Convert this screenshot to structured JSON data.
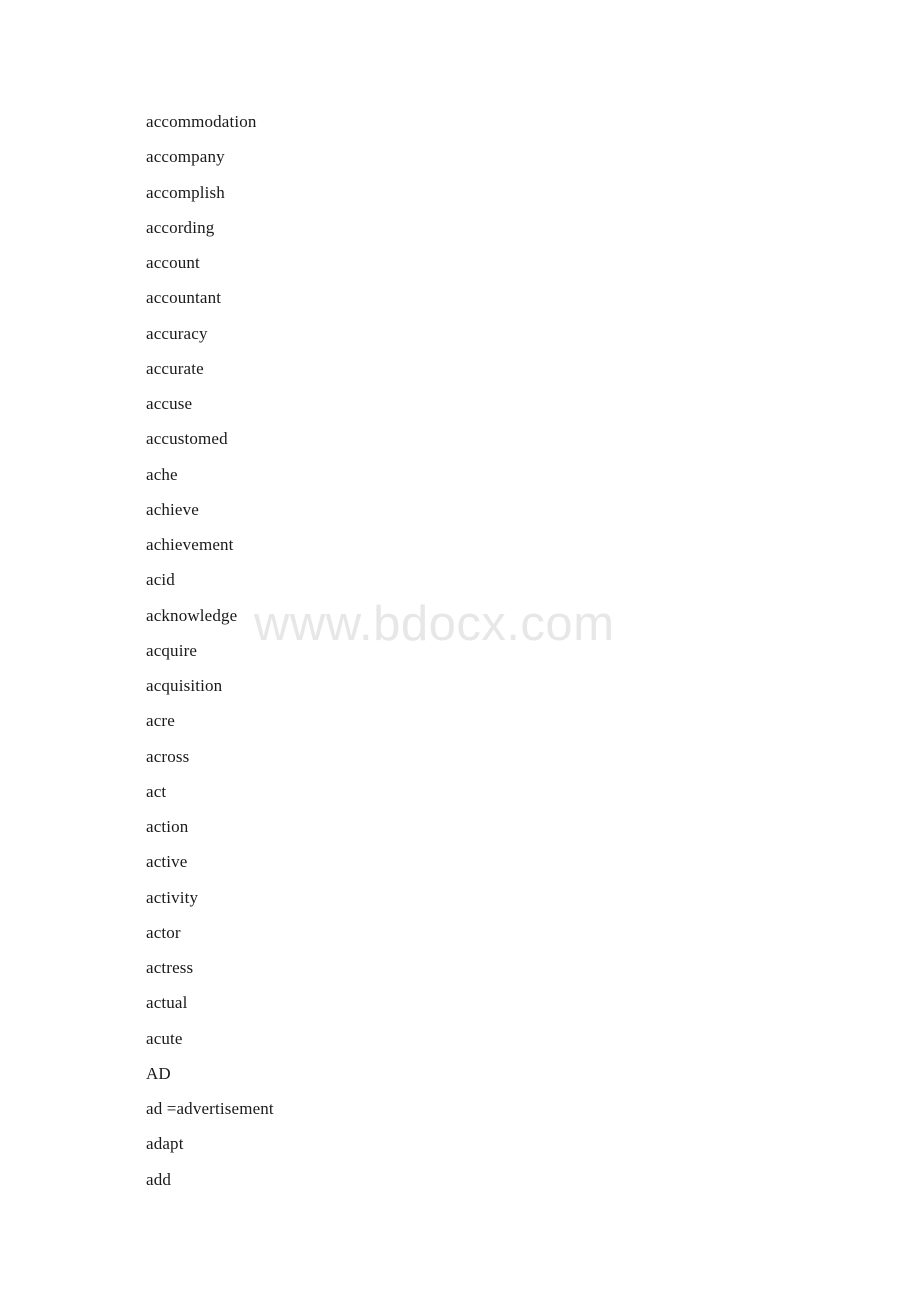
{
  "document": {
    "type": "word-list",
    "background_color": "#ffffff",
    "text_color": "#1a1a1a"
  },
  "watermark": {
    "text": "www.bdocx.com",
    "color": "#e7e7e7"
  },
  "word_list": {
    "items": [
      "accommodation",
      "accompany",
      "accomplish",
      "according",
      "account",
      "accountant",
      "accuracy",
      "accurate",
      "accuse",
      "accustomed",
      "ache",
      "achieve",
      "achievement",
      "acid",
      "acknowledge",
      "acquire",
      "acquisition",
      "acre",
      "across",
      "act",
      "action",
      "active",
      "activity",
      "actor",
      "actress",
      "actual",
      "acute",
      "AD",
      "ad =advertisement",
      "adapt",
      "add"
    ]
  }
}
